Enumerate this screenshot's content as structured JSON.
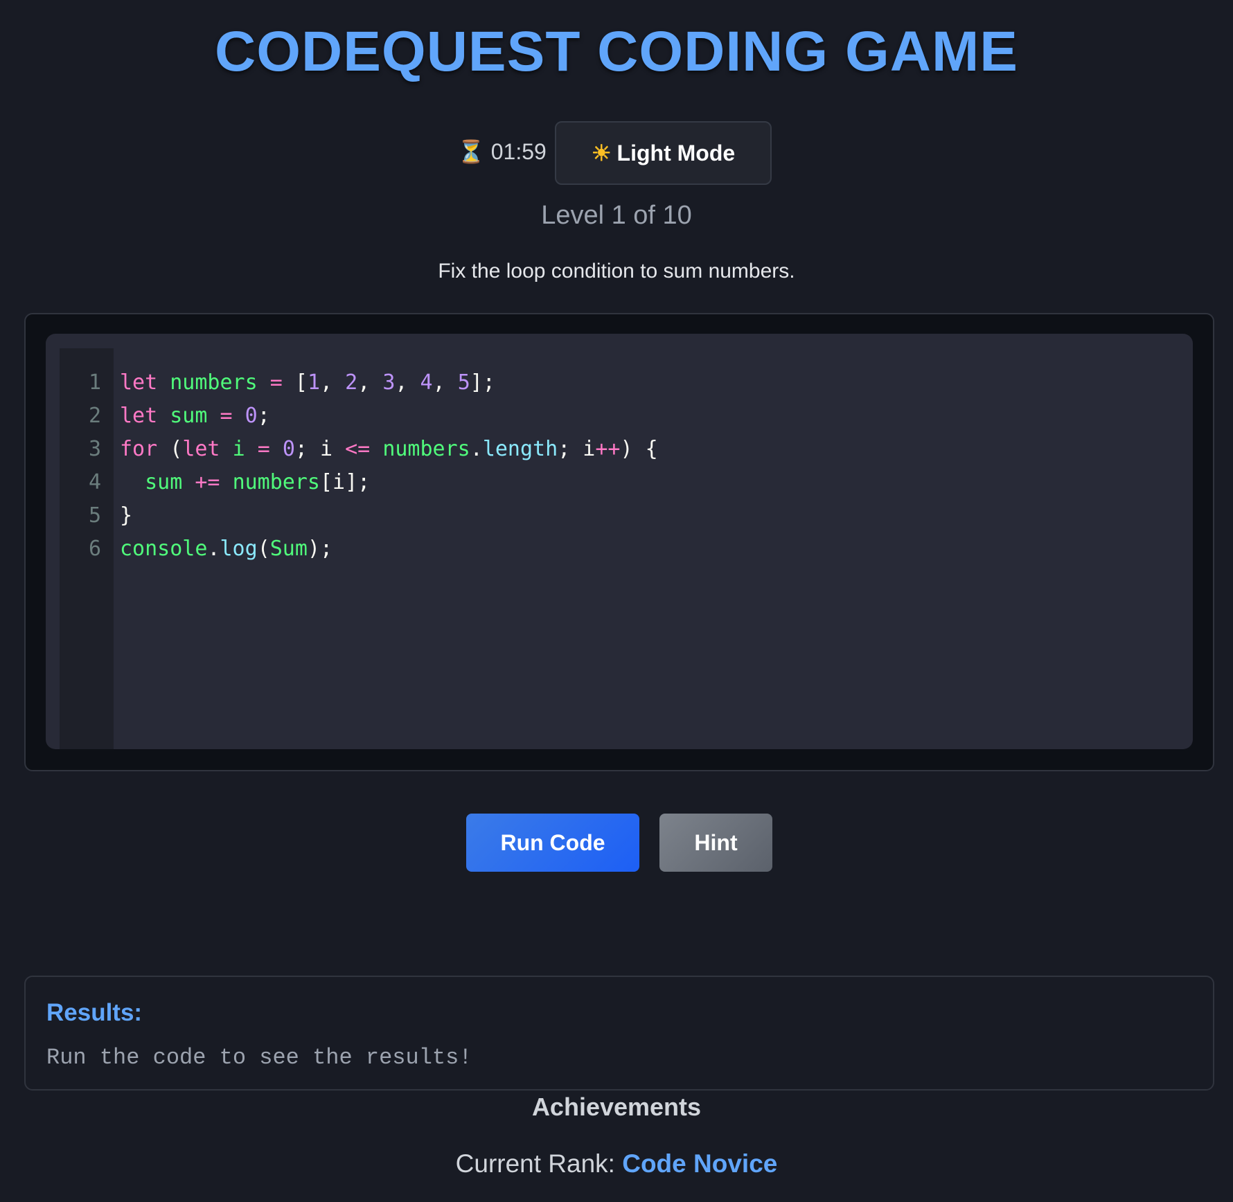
{
  "header": {
    "title": "CODEQUEST CODING GAME"
  },
  "timer": {
    "icon": "hourglass-icon",
    "value": "01:59"
  },
  "theme_toggle": {
    "icon": "sun-icon",
    "label": "Light Mode"
  },
  "level": {
    "text": "Level 1 of 10"
  },
  "task": {
    "description": "Fix the loop condition to sum numbers."
  },
  "editor": {
    "line_numbers": [
      "1",
      "2",
      "3",
      "4",
      "5",
      "6"
    ],
    "lines": [
      [
        [
          "let",
          "k"
        ],
        [
          " ",
          "t"
        ],
        [
          "numbers",
          "v"
        ],
        [
          " ",
          "t"
        ],
        [
          "=",
          "k"
        ],
        [
          " [",
          "t"
        ],
        [
          "1",
          "n"
        ],
        [
          ", ",
          "t"
        ],
        [
          "2",
          "n"
        ],
        [
          ", ",
          "t"
        ],
        [
          "3",
          "n"
        ],
        [
          ", ",
          "t"
        ],
        [
          "4",
          "n"
        ],
        [
          ", ",
          "t"
        ],
        [
          "5",
          "n"
        ],
        [
          "];",
          "t"
        ]
      ],
      [
        [
          "let",
          "k"
        ],
        [
          " ",
          "t"
        ],
        [
          "sum",
          "v"
        ],
        [
          " ",
          "t"
        ],
        [
          "=",
          "k"
        ],
        [
          " ",
          "t"
        ],
        [
          "0",
          "n"
        ],
        [
          ";",
          "t"
        ]
      ],
      [
        [
          "for",
          "k"
        ],
        [
          " (",
          "t"
        ],
        [
          "let",
          "k"
        ],
        [
          " ",
          "t"
        ],
        [
          "i",
          "v"
        ],
        [
          " ",
          "t"
        ],
        [
          "=",
          "k"
        ],
        [
          " ",
          "t"
        ],
        [
          "0",
          "n"
        ],
        [
          "; i ",
          "t"
        ],
        [
          "<=",
          "k"
        ],
        [
          " ",
          "t"
        ],
        [
          "numbers",
          "v"
        ],
        [
          ".",
          "t"
        ],
        [
          "length",
          "p"
        ],
        [
          "; i",
          "t"
        ],
        [
          "++",
          "k"
        ],
        [
          ") {",
          "t"
        ]
      ],
      [
        [
          "  ",
          "t"
        ],
        [
          "sum",
          "v"
        ],
        [
          " ",
          "t"
        ],
        [
          "+=",
          "k"
        ],
        [
          " ",
          "t"
        ],
        [
          "numbers",
          "v"
        ],
        [
          "[i];",
          "t"
        ]
      ],
      [
        [
          "}",
          "t"
        ]
      ],
      [
        [
          "console",
          "v"
        ],
        [
          ".",
          "t"
        ],
        [
          "log",
          "p"
        ],
        [
          "(",
          "t"
        ],
        [
          "Sum",
          "v"
        ],
        [
          ");",
          "t"
        ]
      ]
    ]
  },
  "actions": {
    "run_label": "Run Code",
    "hint_label": "Hint"
  },
  "results": {
    "title": "Results:",
    "text": "Run the code to see the results!"
  },
  "achievements": {
    "title": "Achievements",
    "rank_label": "Current Rank:",
    "rank_value": "Code Novice"
  },
  "colors": {
    "accent": "#60a5fa",
    "run_button": "#2563eb",
    "hint_button": "#6b7280",
    "background": "#181b24"
  }
}
